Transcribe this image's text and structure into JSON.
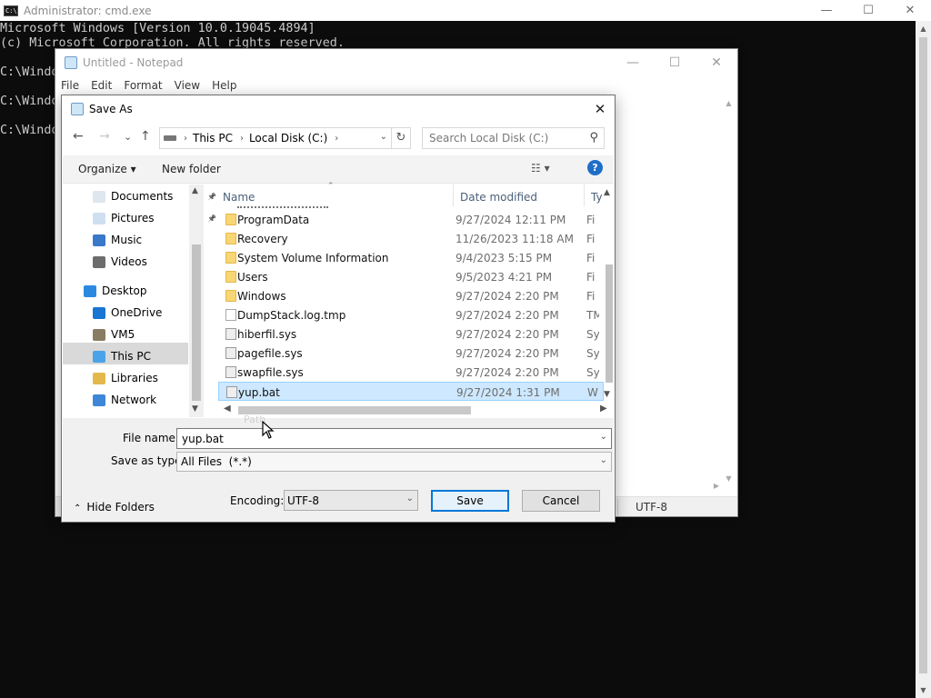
{
  "cmd": {
    "title": "Administrator: cmd.exe",
    "lines": [
      "Microsoft Windows [Version 10.0.19045.4894]",
      "(c) Microsoft Corporation. All rights reserved.",
      "",
      "C:\\Windo",
      "",
      "C:\\Windo",
      "",
      "C:\\Windo"
    ],
    "icon_text": "C:\\"
  },
  "window_controls": {
    "minimize": "—",
    "maximize": "☐",
    "close": "✕"
  },
  "notepad": {
    "title": "Untitled - Notepad",
    "menu": [
      "File",
      "Edit",
      "Format",
      "View",
      "Help"
    ],
    "status_encoding": "UTF-8"
  },
  "saveas": {
    "title": "Save As",
    "close": "✕",
    "nav": {
      "back": "←",
      "forward": "→",
      "recent": "⌄",
      "up": "↑"
    },
    "breadcrumb": [
      "This PC",
      "Local Disk (C:)"
    ],
    "search_placeholder": "Search Local Disk (C:)",
    "toolbar": {
      "organize": "Organize ▾",
      "new_folder": "New folder",
      "view": "☷ ▾",
      "help": "?"
    },
    "nav_pane": [
      {
        "label": "Documents",
        "icon": "documents-icon",
        "pinned": true
      },
      {
        "label": "Pictures",
        "icon": "pictures-icon",
        "pinned": true
      },
      {
        "label": "Music",
        "icon": "music-icon",
        "pinned": false
      },
      {
        "label": "Videos",
        "icon": "videos-icon",
        "pinned": false
      },
      {
        "label": "Desktop",
        "icon": "desktop-icon",
        "pinned": false
      },
      {
        "label": "OneDrive",
        "icon": "onedrive-icon",
        "pinned": false
      },
      {
        "label": "VM5",
        "icon": "user-icon",
        "pinned": false
      },
      {
        "label": "This PC",
        "icon": "this-pc-icon",
        "pinned": false,
        "selected": true
      },
      {
        "label": "Libraries",
        "icon": "libraries-icon",
        "pinned": false
      },
      {
        "label": "Network",
        "icon": "network-icon",
        "pinned": false
      }
    ],
    "columns": {
      "name": "Name",
      "date": "Date modified",
      "type": "Ty"
    },
    "files": [
      {
        "name": "ProgramData",
        "date": "9/27/2024 12:11 PM",
        "type": "Fi",
        "kind": "folder"
      },
      {
        "name": "Recovery",
        "date": "11/26/2023 11:18 AM",
        "type": "Fi",
        "kind": "folder"
      },
      {
        "name": "System Volume Information",
        "date": "9/4/2023 5:15 PM",
        "type": "Fi",
        "kind": "folder"
      },
      {
        "name": "Users",
        "date": "9/5/2023 4:21 PM",
        "type": "Fi",
        "kind": "folder"
      },
      {
        "name": "Windows",
        "date": "9/27/2024 2:20 PM",
        "type": "Fi",
        "kind": "folder"
      },
      {
        "name": "DumpStack.log.tmp",
        "date": "9/27/2024 2:20 PM",
        "type": "TM",
        "kind": "file"
      },
      {
        "name": "hiberfil.sys",
        "date": "9/27/2024 2:20 PM",
        "type": "Sy",
        "kind": "sys"
      },
      {
        "name": "pagefile.sys",
        "date": "9/27/2024 2:20 PM",
        "type": "Sy",
        "kind": "sys"
      },
      {
        "name": "swapfile.sys",
        "date": "9/27/2024 2:20 PM",
        "type": "Sy",
        "kind": "sys"
      },
      {
        "name": "yup.bat",
        "date": "9/27/2024 1:31 PM",
        "type": "W",
        "kind": "sys",
        "selected": true
      }
    ],
    "file_name_label": "File name:",
    "file_name_value": "yup.bat",
    "save_type_label": "Save as type:",
    "save_type_value": "All Files  (*.*)",
    "hide_folders": "Hide Folders",
    "encoding_label": "Encoding:",
    "encoding_value": "UTF-8",
    "save_label": "Save",
    "cancel_label": "Cancel",
    "drag_ghost": "Path"
  }
}
